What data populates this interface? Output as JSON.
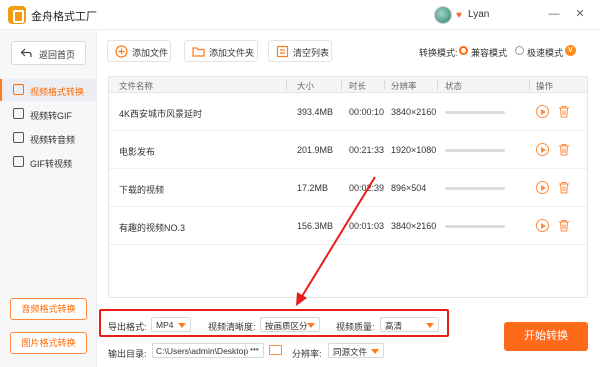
{
  "app": {
    "title": "金舟格式工厂"
  },
  "user": {
    "name": "Lyan"
  },
  "window_controls": {
    "minimize": "—",
    "close": "✕"
  },
  "sidebar": {
    "back_label": "返回首页",
    "items": [
      {
        "label": "视频格式转换",
        "active": true
      },
      {
        "label": "视频转GIF",
        "active": false
      },
      {
        "label": "视频转音频",
        "active": false
      },
      {
        "label": "GIF转视频",
        "active": false
      }
    ],
    "bottom_buttons": [
      "音频格式转换",
      "图片格式转换"
    ]
  },
  "toolbar": {
    "add_file": "添加文件",
    "add_folder": "添加文件夹",
    "clear_list": "清空列表",
    "mode_label": "转换模式:",
    "modes": [
      {
        "label": "兼容模式",
        "selected": true
      },
      {
        "label": "极速模式",
        "selected": false
      }
    ],
    "vip_badge": "V"
  },
  "table": {
    "headers": [
      "文件名称",
      "大小",
      "时长",
      "分辨率",
      "状态",
      "操作"
    ],
    "rows": [
      {
        "name": "4K西安城市风景延时",
        "size": "393.4MB",
        "duration": "00:00:10",
        "resolution": "3840×2160",
        "progress": 0
      },
      {
        "name": "电影发布",
        "size": "201.9MB",
        "duration": "00:21:33",
        "resolution": "1920×1080",
        "progress": 0
      },
      {
        "name": "下载的视频",
        "size": "17.2MB",
        "duration": "00:02:39",
        "resolution": "896×504",
        "progress": 0
      },
      {
        "name": "有趣的视频NO.3",
        "size": "156.3MB",
        "duration": "00:01:03",
        "resolution": "3840×2160",
        "progress": 0
      }
    ]
  },
  "settings": {
    "format_label": "导出格式:",
    "format_value": "MP4",
    "clarity_label": "视频清晰度:",
    "clarity_value": "按画质区分",
    "quality_label": "视频质量:",
    "quality_value": "高清",
    "output_label": "输出目录:",
    "output_path": "C:\\Users\\admin\\Desktop\\",
    "more": "•••",
    "resolution_label": "分辨率:",
    "resolution_value": "同源文件",
    "start_button": "开始转换"
  },
  "colors": {
    "accent": "#ff6a1a",
    "highlight_box": "#e81c1c"
  }
}
